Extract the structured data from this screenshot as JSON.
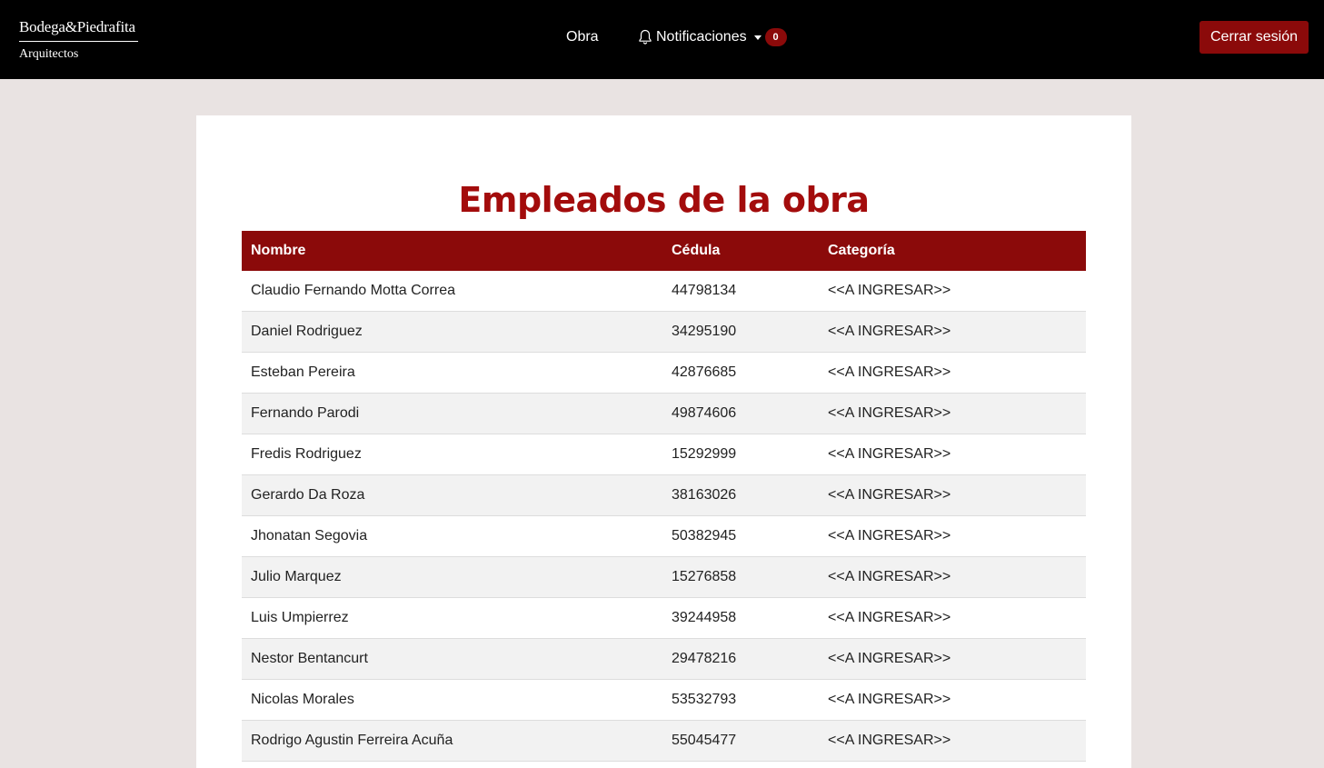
{
  "navbar": {
    "logo_top": "Bodega&Piedrafita",
    "logo_bottom": "Arquitectos",
    "obra_label": "Obra",
    "notifications_label": "Notificaciones",
    "notifications_count": "0",
    "logout_label": "Cerrar sesión"
  },
  "main": {
    "title": "Empleados de la obra",
    "columns": [
      "Nombre",
      "Cédula",
      "Categoría"
    ],
    "rows": [
      {
        "nombre": "Claudio Fernando Motta Correa",
        "cedula": "44798134",
        "categoria": "<<A INGRESAR>>"
      },
      {
        "nombre": "Daniel Rodriguez",
        "cedula": "34295190",
        "categoria": "<<A INGRESAR>>"
      },
      {
        "nombre": "Esteban Pereira",
        "cedula": "42876685",
        "categoria": "<<A INGRESAR>>"
      },
      {
        "nombre": "Fernando Parodi",
        "cedula": "49874606",
        "categoria": "<<A INGRESAR>>"
      },
      {
        "nombre": "Fredis Rodriguez",
        "cedula": "15292999",
        "categoria": "<<A INGRESAR>>"
      },
      {
        "nombre": "Gerardo Da Roza",
        "cedula": "38163026",
        "categoria": "<<A INGRESAR>>"
      },
      {
        "nombre": "Jhonatan Segovia",
        "cedula": "50382945",
        "categoria": "<<A INGRESAR>>"
      },
      {
        "nombre": "Julio Marquez",
        "cedula": "15276858",
        "categoria": "<<A INGRESAR>>"
      },
      {
        "nombre": "Luis Umpierrez",
        "cedula": "39244958",
        "categoria": "<<A INGRESAR>>"
      },
      {
        "nombre": "Nestor Bentancurt",
        "cedula": "29478216",
        "categoria": "<<A INGRESAR>>"
      },
      {
        "nombre": "Nicolas Morales",
        "cedula": "53532793",
        "categoria": "<<A INGRESAR>>"
      },
      {
        "nombre": "Rodrigo Agustin Ferreira Acuña",
        "cedula": "55045477",
        "categoria": "<<A INGRESAR>>"
      }
    ]
  },
  "colors": {
    "accent": "#8b0a0a",
    "title": "#a30c0c",
    "navbar_bg": "#000000",
    "page_bg": "#e9e3e2"
  },
  "icons": {
    "notifications": "bell-icon",
    "dropdown": "caret-down-icon"
  }
}
